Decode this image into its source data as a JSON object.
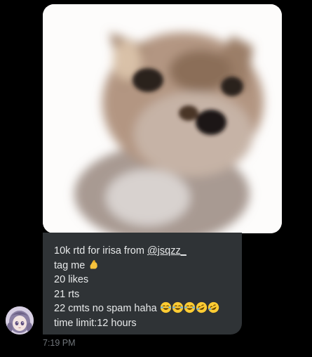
{
  "message": {
    "mention": "@jsqzz_",
    "lines": [
      "10k rtd for irisa from ",
      "tag me",
      "20 likes",
      "21 rts",
      "22 cmts no spam haha",
      "time limit:12 hours"
    ],
    "emojis": {
      "tag": "flexed-biceps",
      "laughs": [
        "joy",
        "joy",
        "joy",
        "rofl",
        "rofl"
      ]
    },
    "timestamp": "7:19 PM"
  },
  "colors": {
    "background": "#000000",
    "bubble": "#2f3336",
    "text": "#e7e9ea",
    "muted": "#71767b"
  }
}
